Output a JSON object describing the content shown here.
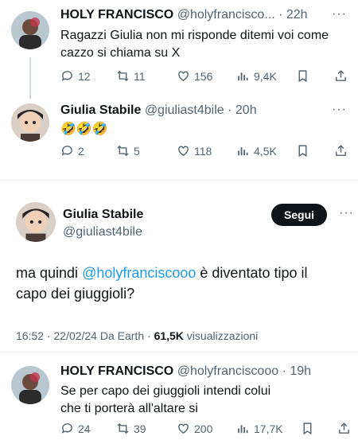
{
  "tweet1": {
    "name": "HOLY FRANCISCO",
    "handle": "@holyfrancisco...",
    "time": "· 22h",
    "text": "Ragazzi Giulia non mi risponde ditemi voi come cazzo si chiama su X",
    "replies": "12",
    "retweets": "11",
    "likes": "156",
    "views": "9,4K"
  },
  "tweet2": {
    "name": "Giulia Stabile",
    "handle": "@giuliast4bile",
    "time": "· 20h",
    "text": "🤣🤣🤣",
    "replies": "2",
    "retweets": "5",
    "likes": "118",
    "views": "4,5K"
  },
  "main": {
    "name": "Giulia Stabile",
    "handle": "@giuliast4bile",
    "follow_label": "Segui",
    "text_before": "ma quindi ",
    "mention": "@holyfranciscooo",
    "text_after": " è diventato tipo il capo dei giuggioli?",
    "meta_time": "16:52 · 22/02/24 Da Earth · ",
    "meta_views": "61,5K",
    "meta_views_label": " visualizzazioni"
  },
  "reply": {
    "name": "HOLY FRANCISCO",
    "handle": "@holyfranciscooo",
    "time": "· 19h",
    "text": "Se per capo dei giuggioli intendi colui che ti porterà all'altare si",
    "replies": "24",
    "retweets": "39",
    "likes": "200",
    "views": "17,7K"
  },
  "more_label": "···",
  "colors": {
    "text": "#0f1419",
    "secondary": "#536471",
    "link": "#1d9bf0",
    "divider": "#eff3f4"
  }
}
